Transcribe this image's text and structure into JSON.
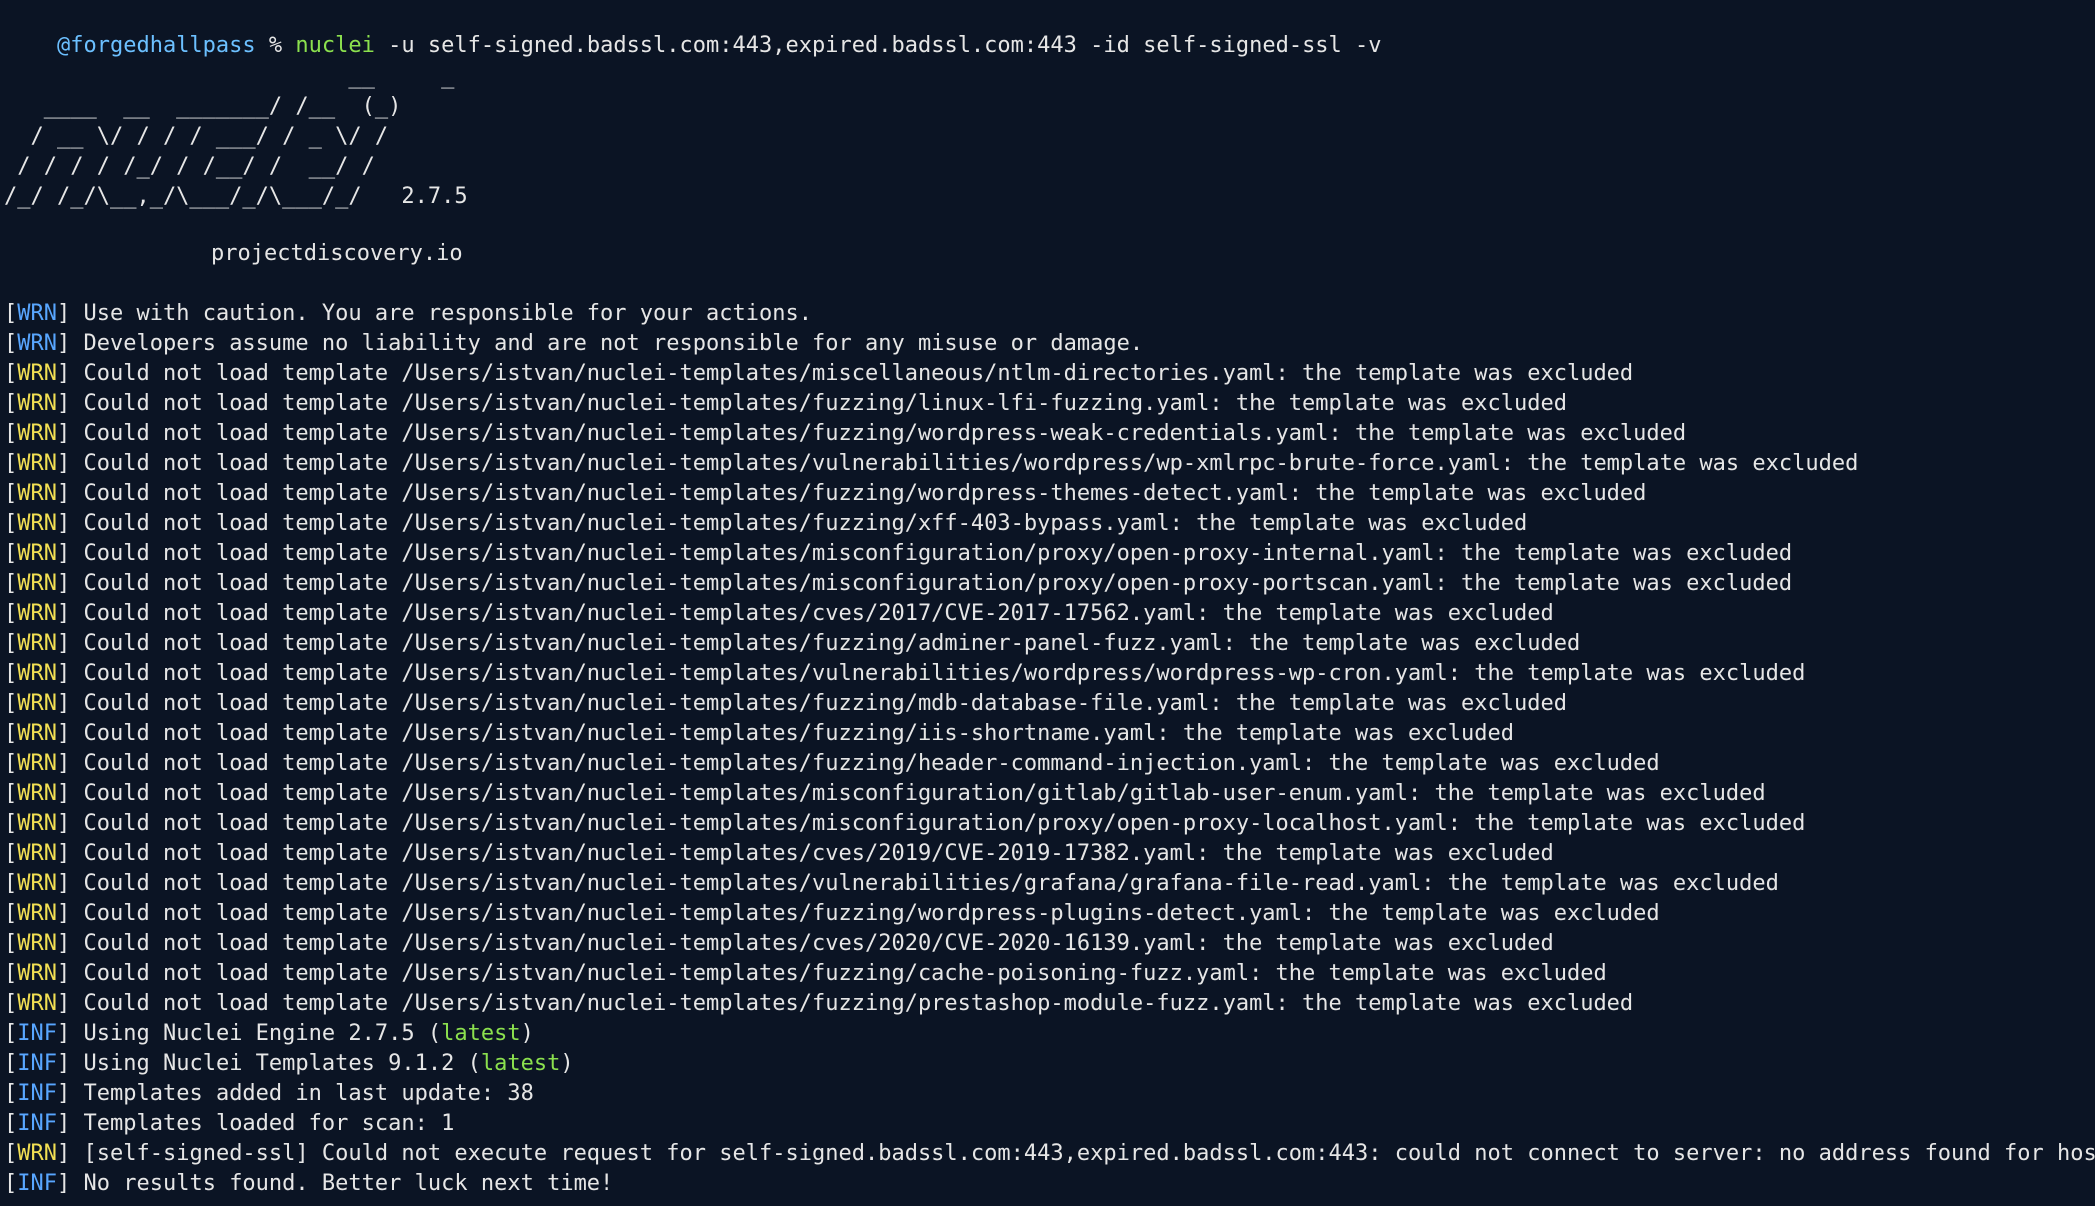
{
  "prompt": {
    "user": "@forgedhallpass",
    "symbol": " % ",
    "command": "nuclei",
    "args": " -u self-signed.badssl.com:443,expired.badssl.com:443 -id self-signed-ssl -v"
  },
  "banner": {
    "art_lines": [
      "                          __     _",
      "   ____  __  _______/ /__  (_)",
      "  / __ \\/ / / / ___/ / _ \\/ /",
      " / / / / /_/ / /__/ /  __/ /",
      "/_/ /_/\\__,_/\\___/_/\\___/_/   2.7.5"
    ],
    "site": "projectdiscovery.io"
  },
  "colors": {
    "background": "#0b1424",
    "text": "#e6e6e6",
    "warn_cyan": "#58a6ff",
    "warn_yellow": "#f2df53",
    "info_blue": "#58a6ff",
    "green": "#8be04e"
  },
  "log": [
    {
      "level": "WRN",
      "color": "cyan",
      "text": " Use with caution. You are responsible for your actions."
    },
    {
      "level": "WRN",
      "color": "cyan",
      "text": " Developers assume no liability and are not responsible for any misuse or damage."
    },
    {
      "level": "WRN",
      "color": "yellow",
      "text": " Could not load template /Users/istvan/nuclei-templates/miscellaneous/ntlm-directories.yaml: the template was excluded"
    },
    {
      "level": "WRN",
      "color": "yellow",
      "text": " Could not load template /Users/istvan/nuclei-templates/fuzzing/linux-lfi-fuzzing.yaml: the template was excluded"
    },
    {
      "level": "WRN",
      "color": "yellow",
      "text": " Could not load template /Users/istvan/nuclei-templates/fuzzing/wordpress-weak-credentials.yaml: the template was excluded"
    },
    {
      "level": "WRN",
      "color": "yellow",
      "text": " Could not load template /Users/istvan/nuclei-templates/vulnerabilities/wordpress/wp-xmlrpc-brute-force.yaml: the template was excluded"
    },
    {
      "level": "WRN",
      "color": "yellow",
      "text": " Could not load template /Users/istvan/nuclei-templates/fuzzing/wordpress-themes-detect.yaml: the template was excluded"
    },
    {
      "level": "WRN",
      "color": "yellow",
      "text": " Could not load template /Users/istvan/nuclei-templates/fuzzing/xff-403-bypass.yaml: the template was excluded"
    },
    {
      "level": "WRN",
      "color": "yellow",
      "text": " Could not load template /Users/istvan/nuclei-templates/misconfiguration/proxy/open-proxy-internal.yaml: the template was excluded"
    },
    {
      "level": "WRN",
      "color": "yellow",
      "text": " Could not load template /Users/istvan/nuclei-templates/misconfiguration/proxy/open-proxy-portscan.yaml: the template was excluded"
    },
    {
      "level": "WRN",
      "color": "yellow",
      "text": " Could not load template /Users/istvan/nuclei-templates/cves/2017/CVE-2017-17562.yaml: the template was excluded"
    },
    {
      "level": "WRN",
      "color": "yellow",
      "text": " Could not load template /Users/istvan/nuclei-templates/fuzzing/adminer-panel-fuzz.yaml: the template was excluded"
    },
    {
      "level": "WRN",
      "color": "yellow",
      "text": " Could not load template /Users/istvan/nuclei-templates/vulnerabilities/wordpress/wordpress-wp-cron.yaml: the template was excluded"
    },
    {
      "level": "WRN",
      "color": "yellow",
      "text": " Could not load template /Users/istvan/nuclei-templates/fuzzing/mdb-database-file.yaml: the template was excluded"
    },
    {
      "level": "WRN",
      "color": "yellow",
      "text": " Could not load template /Users/istvan/nuclei-templates/fuzzing/iis-shortname.yaml: the template was excluded"
    },
    {
      "level": "WRN",
      "color": "yellow",
      "text": " Could not load template /Users/istvan/nuclei-templates/fuzzing/header-command-injection.yaml: the template was excluded"
    },
    {
      "level": "WRN",
      "color": "yellow",
      "text": " Could not load template /Users/istvan/nuclei-templates/misconfiguration/gitlab/gitlab-user-enum.yaml: the template was excluded"
    },
    {
      "level": "WRN",
      "color": "yellow",
      "text": " Could not load template /Users/istvan/nuclei-templates/misconfiguration/proxy/open-proxy-localhost.yaml: the template was excluded"
    },
    {
      "level": "WRN",
      "color": "yellow",
      "text": " Could not load template /Users/istvan/nuclei-templates/cves/2019/CVE-2019-17382.yaml: the template was excluded"
    },
    {
      "level": "WRN",
      "color": "yellow",
      "text": " Could not load template /Users/istvan/nuclei-templates/vulnerabilities/grafana/grafana-file-read.yaml: the template was excluded"
    },
    {
      "level": "WRN",
      "color": "yellow",
      "text": " Could not load template /Users/istvan/nuclei-templates/fuzzing/wordpress-plugins-detect.yaml: the template was excluded"
    },
    {
      "level": "WRN",
      "color": "yellow",
      "text": " Could not load template /Users/istvan/nuclei-templates/cves/2020/CVE-2020-16139.yaml: the template was excluded"
    },
    {
      "level": "WRN",
      "color": "yellow",
      "text": " Could not load template /Users/istvan/nuclei-templates/fuzzing/cache-poisoning-fuzz.yaml: the template was excluded"
    },
    {
      "level": "WRN",
      "color": "yellow",
      "text": " Could not load template /Users/istvan/nuclei-templates/fuzzing/prestashop-module-fuzz.yaml: the template was excluded"
    },
    {
      "level": "INF",
      "color": "blue",
      "text": " Using Nuclei Engine 2.7.5 (",
      "green": "latest",
      "after": ")"
    },
    {
      "level": "INF",
      "color": "blue",
      "text": " Using Nuclei Templates 9.1.2 (",
      "green": "latest",
      "after": ")"
    },
    {
      "level": "INF",
      "color": "blue",
      "text": " Templates added in last update: 38"
    },
    {
      "level": "INF",
      "color": "blue",
      "text": " Templates loaded for scan: 1"
    },
    {
      "level": "WRN",
      "color": "yellow",
      "text": " [self-signed-ssl] Could not execute request for self-signed.badssl.com:443,expired.badssl.com:443: could not connect to server: no address found for host"
    },
    {
      "level": "INF",
      "color": "blue",
      "text": " No results found. Better luck next time!"
    }
  ]
}
